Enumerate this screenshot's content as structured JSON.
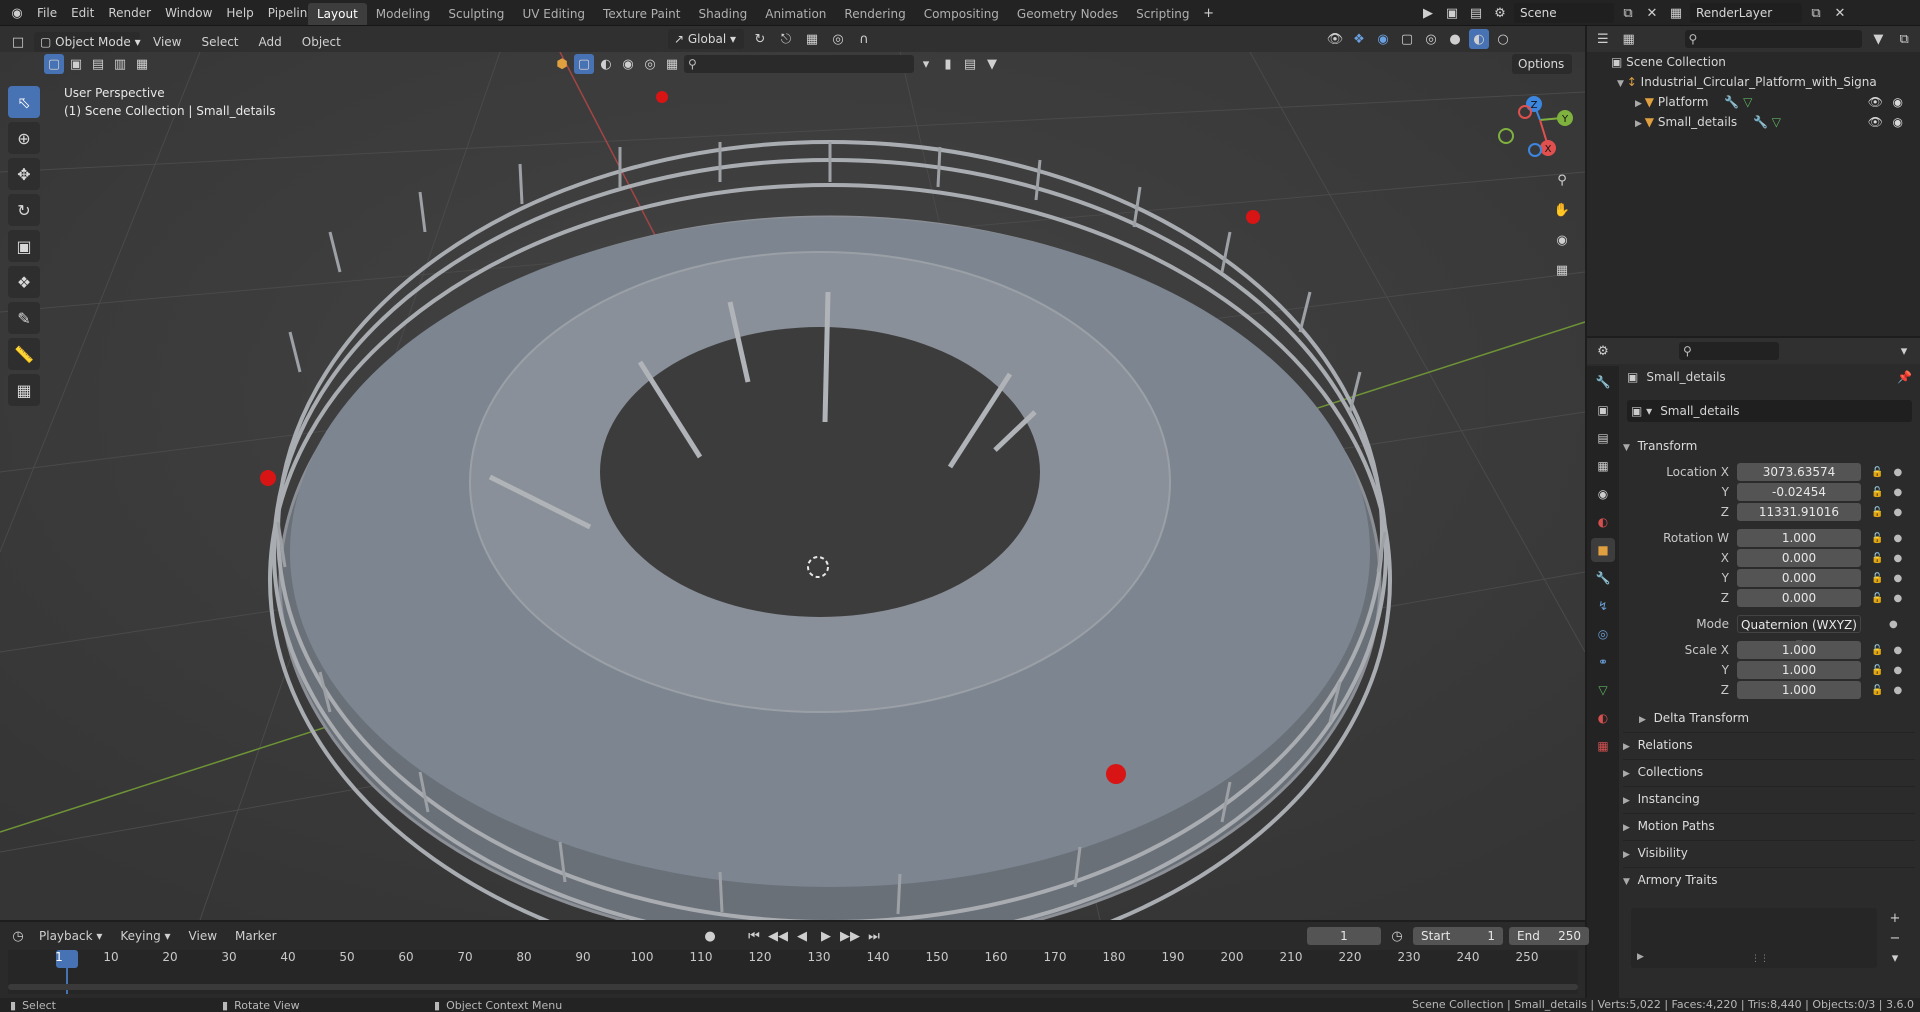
{
  "topbar": {
    "menus": [
      "File",
      "Edit",
      "Render",
      "Window",
      "Help",
      "Pipeline"
    ],
    "workspaces": [
      "Layout",
      "Modeling",
      "Sculpting",
      "UV Editing",
      "Texture Paint",
      "Shading",
      "Animation",
      "Rendering",
      "Compositing",
      "Geometry Nodes",
      "Scripting"
    ],
    "active_workspace": "Layout",
    "scene": "Scene",
    "render_layer": "RenderLayer"
  },
  "viewport_header": {
    "mode": "Object Mode",
    "menus": [
      "View",
      "Select",
      "Add",
      "Object"
    ],
    "transform_orientation": "Global",
    "options_label": "Options"
  },
  "viewport": {
    "perspective_label": "User Perspective",
    "collection_label": "(1) Scene Collection | Small_details",
    "gizmo_axes": [
      "X",
      "Y",
      "Z"
    ]
  },
  "outliner": {
    "root": "Scene Collection",
    "items": [
      {
        "name": "Industrial_Circular_Platform_with_Signa",
        "type": "empty"
      },
      {
        "name": "Platform",
        "type": "mesh"
      },
      {
        "name": "Small_details",
        "type": "mesh"
      }
    ]
  },
  "properties": {
    "object_name": "Small_details",
    "data_name": "Small_details",
    "transform_label": "Transform",
    "location": {
      "label": "Location X",
      "x": "3073.63574",
      "y": "-0.02454",
      "z": "11331.91016"
    },
    "rotation": {
      "label": "Rotation W",
      "w": "1.000",
      "x": "0.000",
      "y": "0.000",
      "z": "0.000"
    },
    "mode_label": "Mode",
    "mode_value": "Quaternion (WXYZ)",
    "scale": {
      "label": "Scale X",
      "x": "1.000",
      "y": "1.000",
      "z": "1.000"
    },
    "axis_labels": {
      "y": "Y",
      "z": "Z",
      "x": "X"
    },
    "sections": [
      "Delta Transform",
      "Relations",
      "Collections",
      "Instancing",
      "Motion Paths",
      "Visibility",
      "Armory Traits"
    ]
  },
  "timeline": {
    "menus": [
      "Playback",
      "Keying",
      "View",
      "Marker"
    ],
    "current_frame": "1",
    "start_label": "Start",
    "start": "1",
    "end_label": "End",
    "end": "250",
    "ticks": [
      "1",
      "10",
      "20",
      "30",
      "40",
      "50",
      "60",
      "70",
      "80",
      "90",
      "100",
      "110",
      "120",
      "130",
      "140",
      "150",
      "160",
      "170",
      "180",
      "190",
      "200",
      "210",
      "220",
      "230",
      "240",
      "250"
    ]
  },
  "statusbar": {
    "left": "Select",
    "middle": "Rotate View",
    "right_menu": "Object Context Menu",
    "stats": "Scene Collection | Small_details | Verts:5,022 | Faces:4,220 | Tris:8,440 | Objects:0/3 | 3.6.0"
  },
  "colors": {
    "accent": "#4772b3",
    "red_axis": "#e0504f",
    "green_axis": "#7fb13f",
    "blue_axis": "#3d86e0",
    "marker_red": "#d81414"
  }
}
